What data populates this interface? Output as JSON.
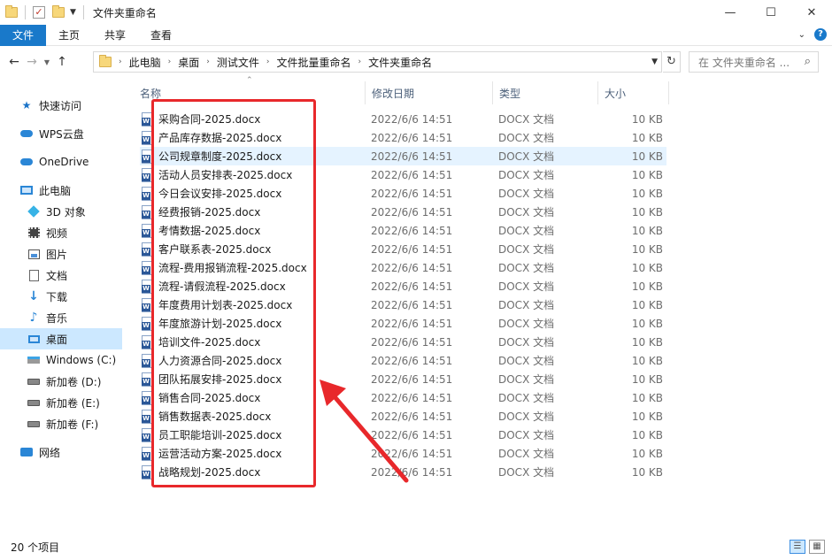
{
  "window": {
    "title": "文件夹重命名",
    "controls": {
      "minimize": "—",
      "maximize": "☐",
      "close": "✕"
    }
  },
  "ribbon": {
    "tabs": [
      {
        "label": "文件",
        "active": true
      },
      {
        "label": "主页"
      },
      {
        "label": "共享"
      },
      {
        "label": "查看"
      }
    ],
    "help": "?"
  },
  "address": {
    "breadcrumbs": [
      "此电脑",
      "桌面",
      "测试文件",
      "文件批量重命名",
      "文件夹重命名"
    ],
    "search_placeholder": "在 文件夹重命名 ..."
  },
  "sidebar": {
    "items": [
      {
        "label": "快速访问",
        "icon": "star-icon"
      },
      {
        "label": "WPS云盘",
        "icon": "cloud-icon"
      },
      {
        "label": "OneDrive",
        "icon": "onedrive-icon"
      },
      {
        "label": "此电脑",
        "icon": "computer-icon"
      },
      {
        "label": "3D 对象",
        "icon": "3d-objects-icon"
      },
      {
        "label": "视频",
        "icon": "video-icon"
      },
      {
        "label": "图片",
        "icon": "picture-icon"
      },
      {
        "label": "文档",
        "icon": "document-icon"
      },
      {
        "label": "下载",
        "icon": "download-icon"
      },
      {
        "label": "音乐",
        "icon": "music-icon"
      },
      {
        "label": "桌面",
        "icon": "desktop-icon",
        "selected": true
      },
      {
        "label": "Windows (C:)",
        "icon": "windows-drive-icon"
      },
      {
        "label": "新加卷 (D:)",
        "icon": "drive-icon"
      },
      {
        "label": "新加卷 (E:)",
        "icon": "drive-icon"
      },
      {
        "label": "新加卷 (F:)",
        "icon": "drive-icon"
      },
      {
        "label": "网络",
        "icon": "network-icon"
      }
    ]
  },
  "columns": {
    "name": "名称",
    "date": "修改日期",
    "type": "类型",
    "size": "大小"
  },
  "files": [
    {
      "name": "采购合同-2025.docx",
      "date": "2022/6/6 14:51",
      "type": "DOCX 文档",
      "size": "10 KB"
    },
    {
      "name": "产品库存数据-2025.docx",
      "date": "2022/6/6 14:51",
      "type": "DOCX 文档",
      "size": "10 KB"
    },
    {
      "name": "公司规章制度-2025.docx",
      "date": "2022/6/6 14:51",
      "type": "DOCX 文档",
      "size": "10 KB",
      "hover": true
    },
    {
      "name": "活动人员安排表-2025.docx",
      "date": "2022/6/6 14:51",
      "type": "DOCX 文档",
      "size": "10 KB"
    },
    {
      "name": "今日会议安排-2025.docx",
      "date": "2022/6/6 14:51",
      "type": "DOCX 文档",
      "size": "10 KB"
    },
    {
      "name": "经费报销-2025.docx",
      "date": "2022/6/6 14:51",
      "type": "DOCX 文档",
      "size": "10 KB"
    },
    {
      "name": "考情数据-2025.docx",
      "date": "2022/6/6 14:51",
      "type": "DOCX 文档",
      "size": "10 KB"
    },
    {
      "name": "客户联系表-2025.docx",
      "date": "2022/6/6 14:51",
      "type": "DOCX 文档",
      "size": "10 KB"
    },
    {
      "name": "流程-费用报销流程-2025.docx",
      "date": "2022/6/6 14:51",
      "type": "DOCX 文档",
      "size": "10 KB"
    },
    {
      "name": "流程-请假流程-2025.docx",
      "date": "2022/6/6 14:51",
      "type": "DOCX 文档",
      "size": "10 KB"
    },
    {
      "name": "年度费用计划表-2025.docx",
      "date": "2022/6/6 14:51",
      "type": "DOCX 文档",
      "size": "10 KB"
    },
    {
      "name": "年度旅游计划-2025.docx",
      "date": "2022/6/6 14:51",
      "type": "DOCX 文档",
      "size": "10 KB"
    },
    {
      "name": "培训文件-2025.docx",
      "date": "2022/6/6 14:51",
      "type": "DOCX 文档",
      "size": "10 KB"
    },
    {
      "name": "人力资源合同-2025.docx",
      "date": "2022/6/6 14:51",
      "type": "DOCX 文档",
      "size": "10 KB"
    },
    {
      "name": "团队拓展安排-2025.docx",
      "date": "2022/6/6 14:51",
      "type": "DOCX 文档",
      "size": "10 KB"
    },
    {
      "name": "销售合同-2025.docx",
      "date": "2022/6/6 14:51",
      "type": "DOCX 文档",
      "size": "10 KB"
    },
    {
      "name": "销售数据表-2025.docx",
      "date": "2022/6/6 14:51",
      "type": "DOCX 文档",
      "size": "10 KB"
    },
    {
      "name": "员工职能培训-2025.docx",
      "date": "2022/6/6 14:51",
      "type": "DOCX 文档",
      "size": "10 KB"
    },
    {
      "name": "运营活动方案-2025.docx",
      "date": "2022/6/6 14:51",
      "type": "DOCX 文档",
      "size": "10 KB"
    },
    {
      "name": "战略规划-2025.docx",
      "date": "2022/6/6 14:51",
      "type": "DOCX 文档",
      "size": "10 KB"
    }
  ],
  "status": {
    "count": "20 个项目"
  },
  "colors": {
    "accent": "#1979ca",
    "selection": "#cce8ff",
    "hover": "#e5f3ff",
    "annotation": "#e8282b"
  }
}
